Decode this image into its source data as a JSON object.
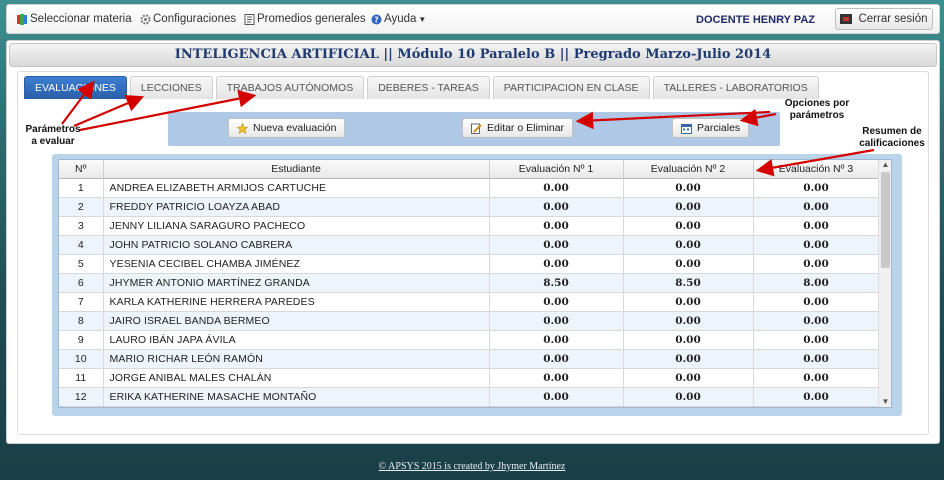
{
  "navbar": {
    "items": [
      {
        "label": "Seleccionar materia",
        "icon": "book-icon"
      },
      {
        "label": "Configuraciones",
        "icon": "gear-icon"
      },
      {
        "label": "Promedios generales",
        "icon": "report-icon"
      },
      {
        "label": "Ayuda",
        "icon": "help-icon"
      }
    ],
    "user": "DOCENTE HENRY PAZ",
    "logout_label": "Cerrar sesión"
  },
  "title": "INTELIGENCIA ARTIFICIAL || Módulo 10 Paralelo B || Pregrado Marzo-Julio 2014",
  "tabs": [
    {
      "label": "EVALUACIONES",
      "active": true
    },
    {
      "label": "LECCIONES",
      "active": false
    },
    {
      "label": "TRABAJOS AUTÓNOMOS",
      "active": false
    },
    {
      "label": "DEBERES - TAREAS",
      "active": false
    },
    {
      "label": "PARTICIPACION EN CLASE",
      "active": false
    },
    {
      "label": "TALLERES - LABORATORIOS",
      "active": false
    }
  ],
  "actions": {
    "new": "Nueva evaluación",
    "edit": "Editar o Eliminar",
    "partials": "Parciales"
  },
  "grid": {
    "columns": [
      "Nº",
      "Estudiante",
      "Evaluación Nº 1",
      "Evaluación Nº 2",
      "Evaluación Nº 3"
    ],
    "rows": [
      [
        "1",
        "ANDREA ELIZABETH ARMIJOS CARTUCHE",
        "0.00",
        "0.00",
        "0.00"
      ],
      [
        "2",
        "FREDDY PATRICIO LOAYZA ABAD",
        "0.00",
        "0.00",
        "0.00"
      ],
      [
        "3",
        "JENNY LILIANA SARAGURO PACHECO",
        "0.00",
        "0.00",
        "0.00"
      ],
      [
        "4",
        "JOHN PATRICIO SOLANO CABRERA",
        "0.00",
        "0.00",
        "0.00"
      ],
      [
        "5",
        "YESENIA CECIBEL CHAMBA JIMÉNEZ",
        "0.00",
        "0.00",
        "0.00"
      ],
      [
        "6",
        "JHYMER ANTONIO MARTÍNEZ GRANDA",
        "8.50",
        "8.50",
        "8.00"
      ],
      [
        "7",
        "KARLA KATHERINE HERRERA PAREDES",
        "0.00",
        "0.00",
        "0.00"
      ],
      [
        "8",
        "JAIRO ISRAEL BANDA BERMEO",
        "0.00",
        "0.00",
        "0.00"
      ],
      [
        "9",
        "LAURO IBÁN JAPA ÁVILA",
        "0.00",
        "0.00",
        "0.00"
      ],
      [
        "10",
        "MARIO RICHAR LEÓN RAMÓN",
        "0.00",
        "0.00",
        "0.00"
      ],
      [
        "11",
        "JORGE ANIBAL MALES CHALÁN",
        "0.00",
        "0.00",
        "0.00"
      ],
      [
        "12",
        "ERIKA KATHERINE MASACHE MONTAÑO",
        "0.00",
        "0.00",
        "0.00"
      ]
    ]
  },
  "annotations": {
    "params": "Parámetros\na evaluar",
    "options": "Opciones por\nparámetros",
    "summary": "Resumen de\ncalificaciones"
  },
  "footer": "© APSYS 2015 is created by Jhymer Martínez",
  "colors": {
    "accent": "#2a5ea8",
    "arrow": "#d40000",
    "action_bar": "#aec8e6"
  }
}
